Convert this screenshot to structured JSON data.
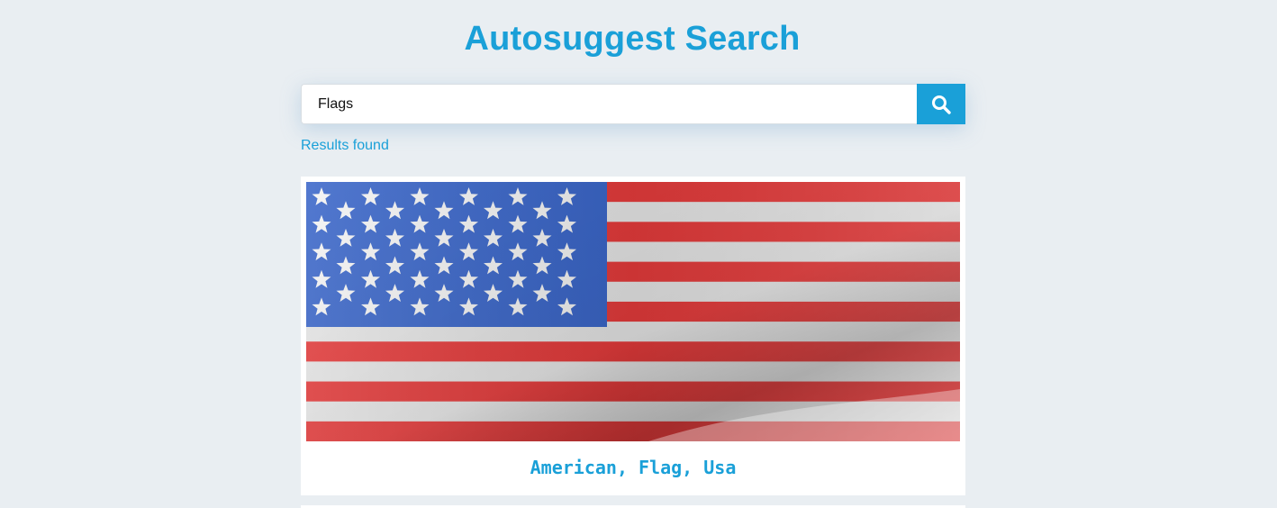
{
  "header": {
    "title": "Autosuggest Search"
  },
  "search": {
    "value": "Flags",
    "button_icon": "search-icon"
  },
  "results": {
    "status": "Results found",
    "items": [
      {
        "caption": "American, Flag, Usa",
        "image": "american-flag-image"
      }
    ]
  },
  "colors": {
    "accent": "#1aa0d8",
    "background": "#e9eef2",
    "card": "#ffffff",
    "flag_red": "#e53b3b",
    "flag_blue": "#3a66c9"
  }
}
